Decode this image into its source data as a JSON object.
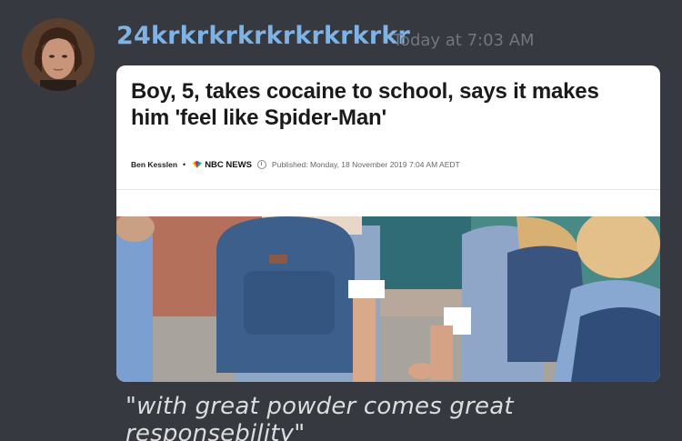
{
  "message": {
    "author": "24krkrkrkrkrkrkrkrkr",
    "timestamp": "Today at 7:03 AM",
    "text": "\"with great powder comes great responsebility\""
  },
  "embed": {
    "headline": "Boy, 5, takes cocaine to school, says it makes him 'feel like Spider-Man'",
    "author": "Ben Kesslen",
    "network": "NBC NEWS",
    "published": "Published: Monday, 18 November 2019 7:04 AM AEDT"
  },
  "colors": {
    "background": "#36393f",
    "username": "#7fb2e5",
    "timestamp": "#72767d",
    "message_text": "#dcddde",
    "embed_bg": "#ffffff"
  },
  "icons": [
    "avatar",
    "nbc-peacock-icon",
    "clock-icon"
  ]
}
